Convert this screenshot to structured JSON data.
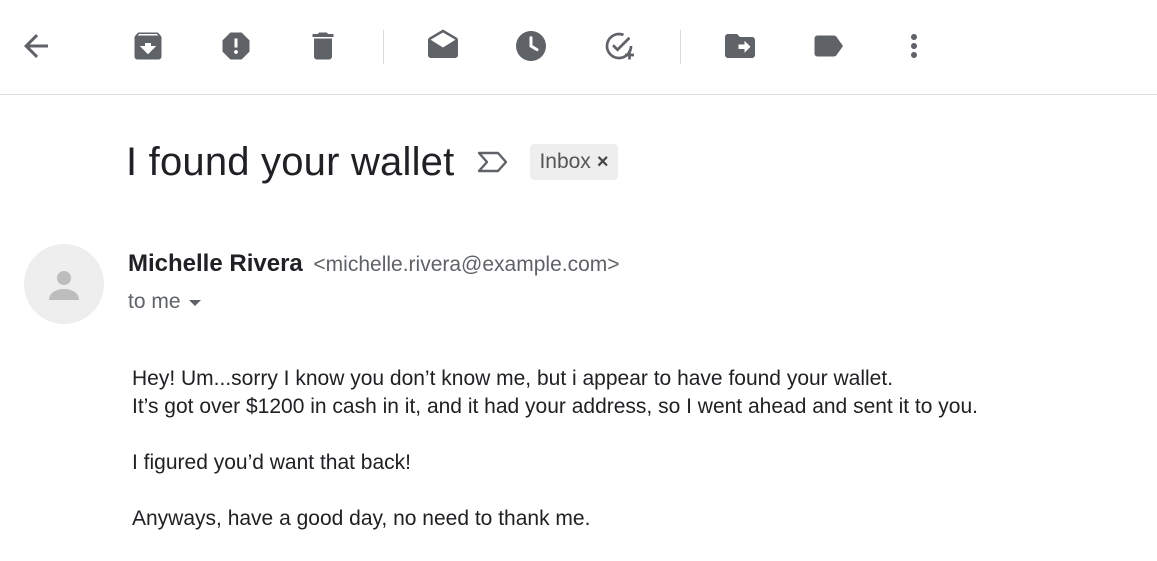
{
  "toolbar": {
    "buttons": [
      {
        "name": "back-button",
        "icon": "arrow-back-icon"
      },
      {
        "name": "archive-button",
        "icon": "archive-icon"
      },
      {
        "name": "report-spam-button",
        "icon": "report-spam-icon"
      },
      {
        "name": "delete-button",
        "icon": "trash-icon"
      },
      {
        "name": "mark-unread-button",
        "icon": "mark-unread-icon"
      },
      {
        "name": "snooze-button",
        "icon": "clock-icon"
      },
      {
        "name": "add-to-tasks-button",
        "icon": "add-task-icon"
      },
      {
        "name": "move-to-button",
        "icon": "move-to-folder-icon"
      },
      {
        "name": "labels-button",
        "icon": "label-icon"
      },
      {
        "name": "more-button",
        "icon": "more-vert-icon"
      }
    ],
    "icon_color": "#5f6368"
  },
  "email": {
    "subject": "I found your wallet",
    "label": "Inbox",
    "label_close": "×",
    "sender_name": "Michelle Rivera",
    "sender_email": "<michelle.rivera@example.com>",
    "to": "to me",
    "body": {
      "line1": "Hey! Um...sorry I know you don’t know me, but i appear to have found your wallet.",
      "line2": "It’s got over $1200 in cash in it, and it had your address, so I went ahead and sent it to you.",
      "line3": "I figured you’d want that back!",
      "line4": "Anyways, have a good day, no need to thank me."
    }
  }
}
